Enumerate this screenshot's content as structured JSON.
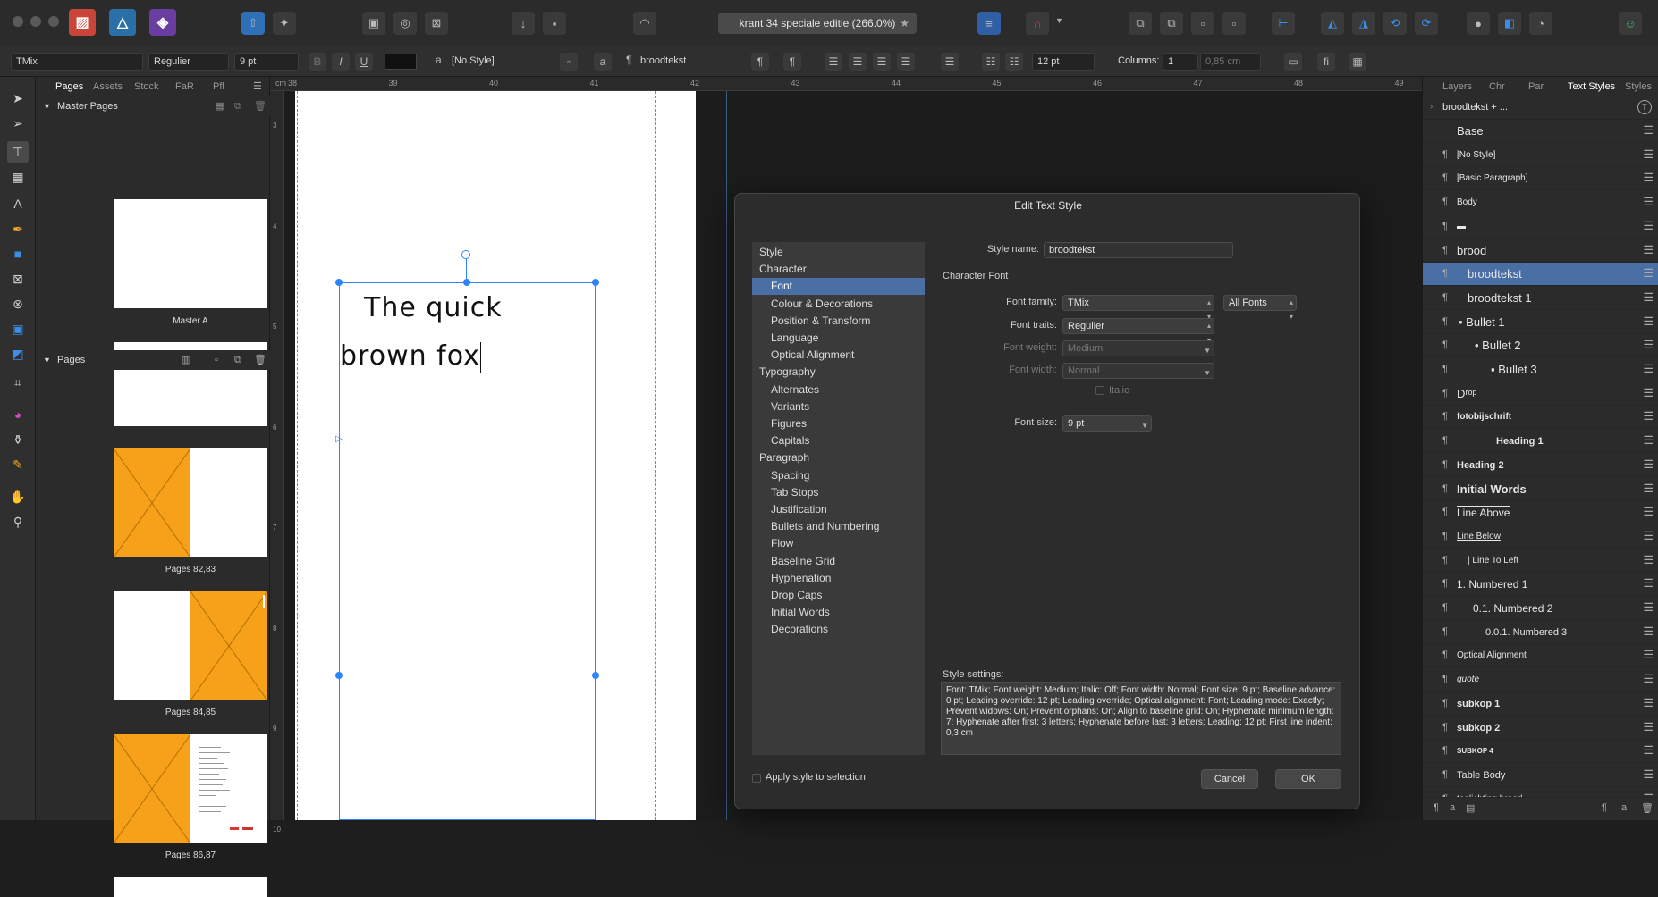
{
  "window": {
    "document_tab": "krant 34 speciale editie (266.0%)",
    "tab_star": "★"
  },
  "context_toolbar": {
    "font_family": "TMix",
    "font_traits": "Regulier",
    "font_size": "9 pt",
    "bold": "B",
    "italic": "I",
    "underline": "U",
    "char_style": "[No Style]",
    "para_style": "broodtekst",
    "leading": "12 pt",
    "columns_label": "Columns:",
    "columns_value": "1",
    "gutter_value": "0,85 cm"
  },
  "left_panel": {
    "tabs": [
      "Pages",
      "Assets",
      "Stock",
      "FaR",
      "Pfl"
    ],
    "master_header": "Master Pages",
    "master_label": "Master A",
    "pages_header": "Pages",
    "page_labels": [
      "Pages 82,83",
      "Pages 84,85",
      "Pages 86,87"
    ]
  },
  "ruler": {
    "unit": "cm",
    "ticks": [
      "38",
      "39",
      "40",
      "41",
      "42",
      "43",
      "44",
      "45",
      "46",
      "47",
      "48",
      "49"
    ],
    "left_ticks": [
      "3",
      "4",
      "5",
      "6",
      "7",
      "8",
      "9",
      "10"
    ]
  },
  "canvas": {
    "line1": "The quick",
    "line2": "brown fox"
  },
  "dialog": {
    "title": "Edit Text Style",
    "nav": [
      {
        "label": "Style",
        "level": 0
      },
      {
        "label": "Character",
        "level": 0
      },
      {
        "label": "Font",
        "level": 1,
        "selected": true
      },
      {
        "label": "Colour & Decorations",
        "level": 1
      },
      {
        "label": "Position & Transform",
        "level": 1
      },
      {
        "label": "Language",
        "level": 1
      },
      {
        "label": "Optical Alignment",
        "level": 1
      },
      {
        "label": "Typography",
        "level": 0
      },
      {
        "label": "Alternates",
        "level": 1
      },
      {
        "label": "Variants",
        "level": 1
      },
      {
        "label": "Figures",
        "level": 1
      },
      {
        "label": "Capitals",
        "level": 1
      },
      {
        "label": "Paragraph",
        "level": 0
      },
      {
        "label": "Spacing",
        "level": 1
      },
      {
        "label": "Tab Stops",
        "level": 1
      },
      {
        "label": "Justification",
        "level": 1
      },
      {
        "label": "Bullets and Numbering",
        "level": 1
      },
      {
        "label": "Flow",
        "level": 1
      },
      {
        "label": "Baseline Grid",
        "level": 1
      },
      {
        "label": "Hyphenation",
        "level": 1
      },
      {
        "label": "Drop Caps",
        "level": 1
      },
      {
        "label": "Initial Words",
        "level": 1
      },
      {
        "label": "Decorations",
        "level": 1
      }
    ],
    "style_name_label": "Style name:",
    "style_name_value": "broodtekst",
    "section_title": "Character Font",
    "font_family_label": "Font family:",
    "font_family_value": "TMix",
    "font_filter": "All Fonts",
    "font_traits_label": "Font traits:",
    "font_traits_value": "Regulier",
    "font_weight_label": "Font weight:",
    "font_weight_value": "Medium",
    "font_width_label": "Font width:",
    "font_width_value": "Normal",
    "italic_label": "Italic",
    "font_size_label": "Font size:",
    "font_size_value": "9 pt",
    "settings_label": "Style settings:",
    "settings_text": "Font: TMix; Font weight: Medium; Italic: Off; Font width: Normal; Font size: 9 pt; Baseline advance: 0 pt; Leading override: 12 pt; Leading override; Optical alignment: Font; Leading mode: Exactly; Prevent widows: On; Prevent orphans: On; Align to baseline grid: On; Hyphenate minimum length: 7; Hyphenate after first: 3 letters; Hyphenate before last: 3 letters; Leading: 12 pt; First line indent: 0,3 cm",
    "apply_label": "Apply style to selection",
    "cancel": "Cancel",
    "ok": "OK"
  },
  "right_panel": {
    "tabs": [
      "Layers",
      "Chr",
      "Par",
      "Text Styles",
      "Styles"
    ],
    "search_value": "broodtekst + ...",
    "styles": [
      {
        "name": "Base",
        "indent": 0,
        "bold": false,
        "size": 13,
        "pilcrow": ""
      },
      {
        "name": "[No Style]",
        "indent": 0,
        "size": 10,
        "pilcrow": "¶"
      },
      {
        "name": "[Basic Paragraph]",
        "indent": 0,
        "size": 10,
        "pilcrow": "¶"
      },
      {
        "name": "Body",
        "indent": 0,
        "size": 10,
        "pilcrow": "¶"
      },
      {
        "name": "▬",
        "indent": 0,
        "size": 10,
        "pilcrow": "¶"
      },
      {
        "name": "brood",
        "indent": 0,
        "size": 13,
        "pilcrow": "¶"
      },
      {
        "name": "broodtekst",
        "indent": 12,
        "size": 13,
        "pilcrow": "¶",
        "selected": true
      },
      {
        "name": "broodtekst 1",
        "indent": 12,
        "size": 13,
        "pilcrow": "¶"
      },
      {
        "name": "•   Bullet 1",
        "indent": 2,
        "size": 13,
        "pilcrow": "¶"
      },
      {
        "name": "•   Bullet 2",
        "indent": 20,
        "size": 13,
        "pilcrow": "¶"
      },
      {
        "name": "▪   Bullet 3",
        "indent": 38,
        "size": 13,
        "pilcrow": "¶"
      },
      {
        "name": "Dʳᵒᵖ",
        "indent": 0,
        "size": 13,
        "pilcrow": "¶"
      },
      {
        "name": "fotobijschrift",
        "indent": 0,
        "size": 10,
        "bold": true,
        "pilcrow": "¶"
      },
      {
        "name": "Heading 1",
        "indent": 44,
        "size": 11,
        "bold": true,
        "pilcrow": "¶"
      },
      {
        "name": "Heading 2",
        "indent": 0,
        "size": 11,
        "bold": true,
        "pilcrow": "¶"
      },
      {
        "name": "Initial Words",
        "indent": 0,
        "size": 13,
        "bold": true,
        "pilcrow": "¶"
      },
      {
        "name": "Line Above",
        "indent": 0,
        "size": 12,
        "pilcrow": "¶",
        "deco": "overline"
      },
      {
        "name": "Line Below",
        "indent": 0,
        "size": 10,
        "pilcrow": "¶",
        "deco": "underline"
      },
      {
        "name": "|    Line To Left",
        "indent": 12,
        "size": 10,
        "pilcrow": "¶"
      },
      {
        "name": "1.  Numbered 1",
        "indent": 0,
        "size": 12,
        "pilcrow": "¶"
      },
      {
        "name": "0.1.    Numbered 2",
        "indent": 18,
        "size": 12,
        "pilcrow": "¶"
      },
      {
        "name": "0.0.1.     Numbered 3",
        "indent": 32,
        "size": 11,
        "pilcrow": "¶"
      },
      {
        "name": "Optical Alignment",
        "indent": 0,
        "size": 10,
        "pilcrow": "¶"
      },
      {
        "name": "quote",
        "indent": 0,
        "size": 10,
        "italic": true,
        "pilcrow": "¶"
      },
      {
        "name": "subkop 1",
        "indent": 0,
        "size": 11,
        "bold": true,
        "pilcrow": "¶"
      },
      {
        "name": "subkop 2",
        "indent": 0,
        "size": 11,
        "bold": true,
        "pilcrow": "¶"
      },
      {
        "name": "SUBKOP 4",
        "indent": 0,
        "size": 8,
        "bold": true,
        "pilcrow": "¶"
      },
      {
        "name": "Table Body",
        "indent": 0,
        "size": 11,
        "pilcrow": "¶"
      },
      {
        "name": "toelichting brood",
        "indent": 0,
        "size": 10,
        "pilcrow": "¶"
      }
    ]
  },
  "colors": {
    "accent": "#4a6fa5",
    "frame": "#2e83ff",
    "page_orange": "#f7a11a"
  }
}
